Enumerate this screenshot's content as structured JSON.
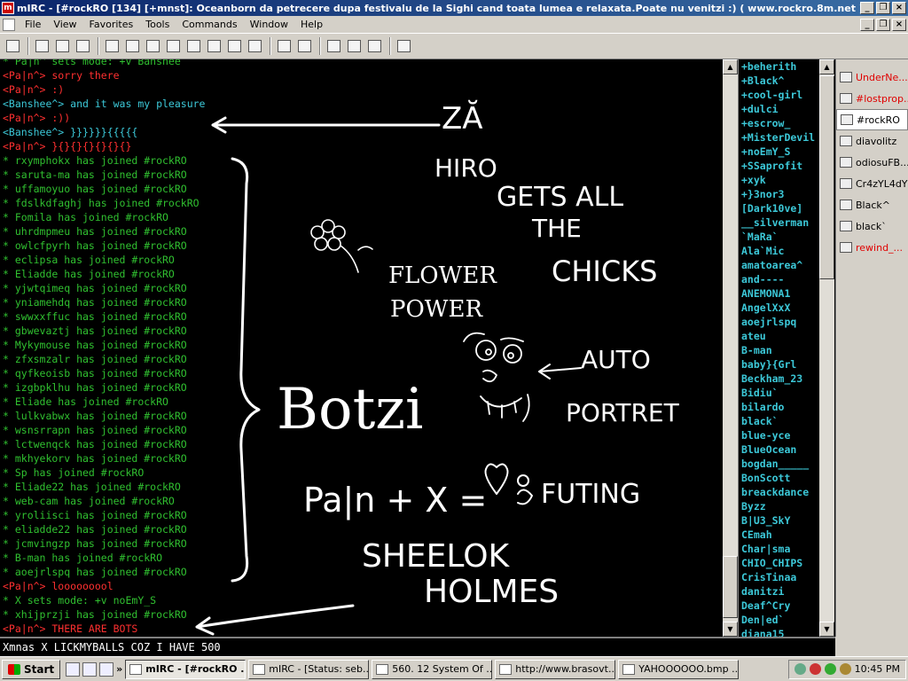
{
  "window": {
    "title": "mIRC - [#rockRO [134] [+mnst]: Oceanborn da petrecere dupa festivalu de la Sighi cand toata lumea e relaxata.Poate nu venitzi :) ( www.rockro.8m.net )]",
    "app_icon_label": "m",
    "buttons": [
      "_",
      "❐",
      "×"
    ],
    "mdi_buttons": [
      "_",
      "❐",
      "×"
    ]
  },
  "menu": [
    "File",
    "View",
    "Favorites",
    "Tools",
    "Commands",
    "Window",
    "Help"
  ],
  "toolbar": [
    "connect-icon",
    "options-icon",
    "folder-icon",
    "address-book-icon",
    "channel-list-icon",
    "list-icon",
    "timer-icon",
    "colors-icon",
    "send-icon",
    "receive-icon",
    "dcc-icon",
    "notify-icon",
    "log-icon",
    "url-icon",
    "tile-icon",
    "cascade-icon",
    "arrange-icon",
    "help-icon"
  ],
  "chat": [
    {
      "t": "* Pa|n^ sets mode: +v Banshee",
      "c": "#30c030"
    },
    {
      "t": "<Pa|n^> sorry  there",
      "c": "#ff3030"
    },
    {
      "t": "<Pa|n^> :)",
      "c": "#ff3030"
    },
    {
      "t": "<Banshee^> and it was my pleasure",
      "c": "#3cc8d8"
    },
    {
      "t": "<Pa|n^> :))",
      "c": "#ff3030"
    },
    {
      "t": "<Banshee^> }}}}}}{{{{{",
      "c": "#3cc8d8"
    },
    {
      "t": "<Pa|n^> }{}{}{}{}{}{}",
      "c": "#ff3030"
    },
    {
      "t": "* rxymphokx has joined #rockRO",
      "c": "#30c030"
    },
    {
      "t": "* saruta-ma has joined #rockRO",
      "c": "#30c030"
    },
    {
      "t": "* uffamoyuo has joined #rockRO",
      "c": "#30c030"
    },
    {
      "t": "* fdslkdfaghj has joined #rockRO",
      "c": "#30c030"
    },
    {
      "t": "* Fomila has joined #rockRO",
      "c": "#30c030"
    },
    {
      "t": "* uhrdmpmeu has joined #rockRO",
      "c": "#30c030"
    },
    {
      "t": "* owlcfpyrh has joined #rockRO",
      "c": "#30c030"
    },
    {
      "t": "* eclipsa has joined #rockRO",
      "c": "#30c030"
    },
    {
      "t": "* Eliadde has joined #rockRO",
      "c": "#30c030"
    },
    {
      "t": "* yjwtqimeq has joined #rockRO",
      "c": "#30c030"
    },
    {
      "t": "* yniamehdq has joined #rockRO",
      "c": "#30c030"
    },
    {
      "t": "* swwxxffuc has joined #rockRO",
      "c": "#30c030"
    },
    {
      "t": "* gbwevaztj has joined #rockRO",
      "c": "#30c030"
    },
    {
      "t": "* Mykymouse has joined #rockRO",
      "c": "#30c030"
    },
    {
      "t": "* zfxsmzalr has joined #rockRO",
      "c": "#30c030"
    },
    {
      "t": "* qyfkeoisb has joined #rockRO",
      "c": "#30c030"
    },
    {
      "t": "* izgbpklhu has joined #rockRO",
      "c": "#30c030"
    },
    {
      "t": "* Eliade has joined #rockRO",
      "c": "#30c030"
    },
    {
      "t": "* lulkvabwx has joined #rockRO",
      "c": "#30c030"
    },
    {
      "t": "* wsnsrrapn has joined #rockRO",
      "c": "#30c030"
    },
    {
      "t": "* lctwenqck has joined #rockRO",
      "c": "#30c030"
    },
    {
      "t": "* mkhyekorv has joined #rockRO",
      "c": "#30c030"
    },
    {
      "t": "* Sp has joined #rockRO",
      "c": "#30c030"
    },
    {
      "t": "* Eliade22 has joined #rockRO",
      "c": "#30c030"
    },
    {
      "t": "* web-cam has joined #rockRO",
      "c": "#30c030"
    },
    {
      "t": "* yroliisci has joined #rockRO",
      "c": "#30c030"
    },
    {
      "t": "* eliadde22 has joined #rockRO",
      "c": "#30c030"
    },
    {
      "t": "* jcmvingzp has joined #rockRO",
      "c": "#30c030"
    },
    {
      "t": "* B-man has joined #rockRO",
      "c": "#30c030"
    },
    {
      "t": "* aoejrlspq has joined #rockRO",
      "c": "#30c030"
    },
    {
      "t": "<Pa|n^> looooooool",
      "c": "#ff3030"
    },
    {
      "t": "* X sets mode: +v noEmY_S",
      "c": "#30c030"
    },
    {
      "t": "* xhijprzji has joined #rockRO",
      "c": "#30c030"
    },
    {
      "t": "<Pa|n^> THERE ARE BOTS",
      "c": "#ff3030"
    }
  ],
  "nicks": [
    "+beherith",
    "+Black^",
    "+cool-girl",
    "+dulci",
    "+escrow_",
    "+MisterDevil",
    "+noEmY_S",
    "+SSaprofit",
    "+xyk",
    "+}3nor3",
    "[Dark10ve]",
    "__silverman",
    "`MaRa`",
    "Ala`Mic",
    "amatoarea^",
    "and----",
    "ANEMONA1",
    "AngelXxX",
    "aoejrlspq",
    "ateu",
    "B-man",
    "baby}{Grl",
    "Beckham_23",
    "Bidiu`",
    "bilardo",
    "black`",
    "blue-yce",
    "BlueOcean",
    "bogdan_____",
    "BonScott",
    "breackdance",
    "Byzz",
    "B|U3_SkY",
    "CEmah",
    "Char|sma",
    "CHIO_CHIPS",
    "CrisTinaa",
    "danitzi",
    "Deaf^Cry",
    "Den|ed`",
    "diana15"
  ],
  "switchbar": [
    {
      "label": "UnderNe...",
      "color": "#e00000",
      "active": false
    },
    {
      "label": "#lostprop...",
      "color": "#e00000",
      "active": false
    },
    {
      "label": "#rockRO",
      "color": "#000000",
      "active": true
    },
    {
      "label": "diavolitz",
      "color": "#000000",
      "active": false
    },
    {
      "label": "odiosuFB...",
      "color": "#000000",
      "active": false
    },
    {
      "label": "Cr4zYL4dY",
      "color": "#000000",
      "active": false
    },
    {
      "label": "Black^",
      "color": "#000000",
      "active": false
    },
    {
      "label": "black`",
      "color": "#000000",
      "active": false
    },
    {
      "label": "rewind_...",
      "color": "#e00000",
      "active": false
    }
  ],
  "drawing": {
    "za": "ZĂ",
    "hiro": "HIRO",
    "gets_all": "GETS ALL",
    "the": "THE",
    "chicks": "CHICKS",
    "flower": "FLOWER",
    "power": "POWER",
    "auto": "AUTO",
    "portret": "PORTRET",
    "botzi": "Botzi",
    "formula": "Pa|n + X =",
    "futing": "FUTING",
    "sheelok": "SHEELOK",
    "holmes": "HOLMES"
  },
  "input_text": "Xmnas X LICKMYBALLS COZ I HAVE 500",
  "taskbar": {
    "start": "Start",
    "tasks": [
      {
        "label": "mIRC - [#rockRO ...",
        "active": true
      },
      {
        "label": "mIRC - [Status: seb...",
        "active": false
      },
      {
        "label": "560. 12 System Of ...",
        "active": false
      },
      {
        "label": "http://www.brasovt...",
        "active": false
      },
      {
        "label": "YAHOOOOOO.bmp ...",
        "active": false
      }
    ],
    "clock": "10:45 PM"
  }
}
